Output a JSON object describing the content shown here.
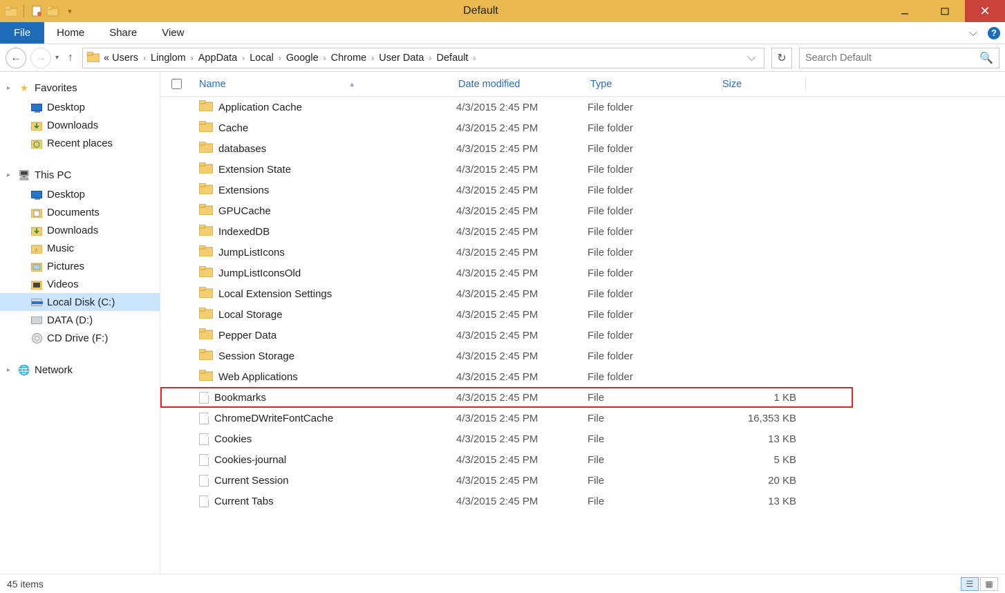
{
  "window": {
    "title": "Default"
  },
  "ribbon": {
    "file": "File",
    "tabs": [
      "Home",
      "Share",
      "View"
    ]
  },
  "breadcrumb": {
    "items": [
      "Users",
      "Linglom",
      "AppData",
      "Local",
      "Google",
      "Chrome",
      "User Data",
      "Default"
    ],
    "prefix_chevrons": "«"
  },
  "search": {
    "placeholder": "Search Default"
  },
  "sidebar": {
    "favorites": {
      "label": "Favorites",
      "items": [
        "Desktop",
        "Downloads",
        "Recent places"
      ]
    },
    "thispc": {
      "label": "This PC",
      "items": [
        "Desktop",
        "Documents",
        "Downloads",
        "Music",
        "Pictures",
        "Videos",
        "Local Disk (C:)",
        "DATA (D:)",
        "CD Drive (F:)"
      ]
    },
    "network": {
      "label": "Network"
    },
    "selected": "Local Disk (C:)"
  },
  "columns": {
    "name": "Name",
    "date": "Date modified",
    "type": "Type",
    "size": "Size"
  },
  "files": [
    {
      "name": "Application Cache",
      "date": "4/3/2015 2:45 PM",
      "type": "File folder",
      "size": "",
      "icon": "folder"
    },
    {
      "name": "Cache",
      "date": "4/3/2015 2:45 PM",
      "type": "File folder",
      "size": "",
      "icon": "folder"
    },
    {
      "name": "databases",
      "date": "4/3/2015 2:45 PM",
      "type": "File folder",
      "size": "",
      "icon": "folder"
    },
    {
      "name": "Extension State",
      "date": "4/3/2015 2:45 PM",
      "type": "File folder",
      "size": "",
      "icon": "folder"
    },
    {
      "name": "Extensions",
      "date": "4/3/2015 2:45 PM",
      "type": "File folder",
      "size": "",
      "icon": "folder"
    },
    {
      "name": "GPUCache",
      "date": "4/3/2015 2:45 PM",
      "type": "File folder",
      "size": "",
      "icon": "folder"
    },
    {
      "name": "IndexedDB",
      "date": "4/3/2015 2:45 PM",
      "type": "File folder",
      "size": "",
      "icon": "folder"
    },
    {
      "name": "JumpListIcons",
      "date": "4/3/2015 2:45 PM",
      "type": "File folder",
      "size": "",
      "icon": "folder"
    },
    {
      "name": "JumpListIconsOld",
      "date": "4/3/2015 2:45 PM",
      "type": "File folder",
      "size": "",
      "icon": "folder"
    },
    {
      "name": "Local Extension Settings",
      "date": "4/3/2015 2:45 PM",
      "type": "File folder",
      "size": "",
      "icon": "folder"
    },
    {
      "name": "Local Storage",
      "date": "4/3/2015 2:45 PM",
      "type": "File folder",
      "size": "",
      "icon": "folder"
    },
    {
      "name": "Pepper Data",
      "date": "4/3/2015 2:45 PM",
      "type": "File folder",
      "size": "",
      "icon": "folder"
    },
    {
      "name": "Session Storage",
      "date": "4/3/2015 2:45 PM",
      "type": "File folder",
      "size": "",
      "icon": "folder"
    },
    {
      "name": "Web Applications",
      "date": "4/3/2015 2:45 PM",
      "type": "File folder",
      "size": "",
      "icon": "folder"
    },
    {
      "name": "Bookmarks",
      "date": "4/3/2015 2:45 PM",
      "type": "File",
      "size": "1 KB",
      "icon": "file",
      "highlight": true
    },
    {
      "name": "ChromeDWriteFontCache",
      "date": "4/3/2015 2:45 PM",
      "type": "File",
      "size": "16,353 KB",
      "icon": "file"
    },
    {
      "name": "Cookies",
      "date": "4/3/2015 2:45 PM",
      "type": "File",
      "size": "13 KB",
      "icon": "file"
    },
    {
      "name": "Cookies-journal",
      "date": "4/3/2015 2:45 PM",
      "type": "File",
      "size": "5 KB",
      "icon": "file"
    },
    {
      "name": "Current Session",
      "date": "4/3/2015 2:45 PM",
      "type": "File",
      "size": "20 KB",
      "icon": "file"
    },
    {
      "name": "Current Tabs",
      "date": "4/3/2015 2:45 PM",
      "type": "File",
      "size": "13 KB",
      "icon": "file"
    }
  ],
  "status": {
    "count": "45 items"
  }
}
